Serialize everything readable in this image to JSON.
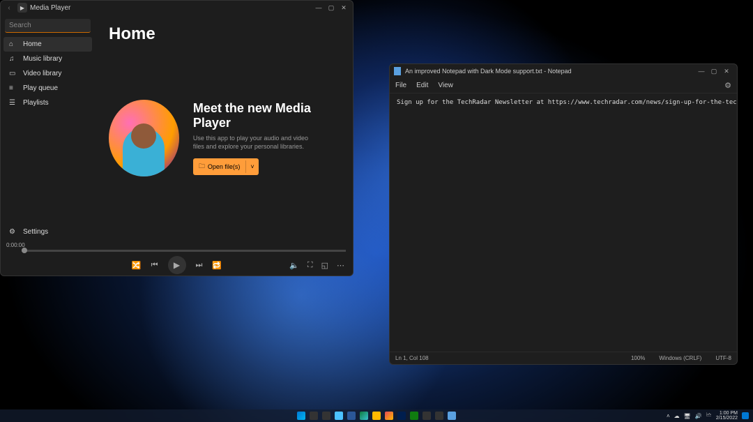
{
  "media_player": {
    "title": "Media Player",
    "search_placeholder": "Search",
    "nav": [
      {
        "icon": "⌂",
        "label": "Home",
        "active": true
      },
      {
        "icon": "♫",
        "label": "Music library"
      },
      {
        "icon": "▭",
        "label": "Video library"
      },
      {
        "icon": "≡",
        "label": "Play queue"
      },
      {
        "icon": "☰",
        "label": "Playlists"
      }
    ],
    "settings_label": "Settings",
    "main_heading": "Home",
    "hero_title": "Meet the new Media Player",
    "hero_desc": "Use this app to play your audio and video files and explore your personal libraries.",
    "open_btn": "Open file(s)",
    "time": "0:00:00"
  },
  "notepad": {
    "title": "An improved Notepad with Dark Mode support.txt - Notepad",
    "menus": [
      "File",
      "Edit",
      "View"
    ],
    "content": "Sign up for the TechRadar Newsletter at https://www.techradar.com/news/sign-up-for-the-techradar-newsletter",
    "status": {
      "pos": "Ln 1, Col 108",
      "zoom": "100%",
      "eol": "Windows (CRLF)",
      "enc": "UTF-8"
    }
  },
  "tray": {
    "time": "1:00 PM",
    "date": "2/15/2022"
  },
  "taskbar_colors": [
    "#0078d4",
    "#333",
    "#333",
    "#4cc2ff",
    "#2b5797",
    "#00a4ef",
    "#ffb900",
    "#e74856",
    "#31c48d",
    "#107c10",
    "#888",
    "#888",
    "#888",
    "#888"
  ]
}
